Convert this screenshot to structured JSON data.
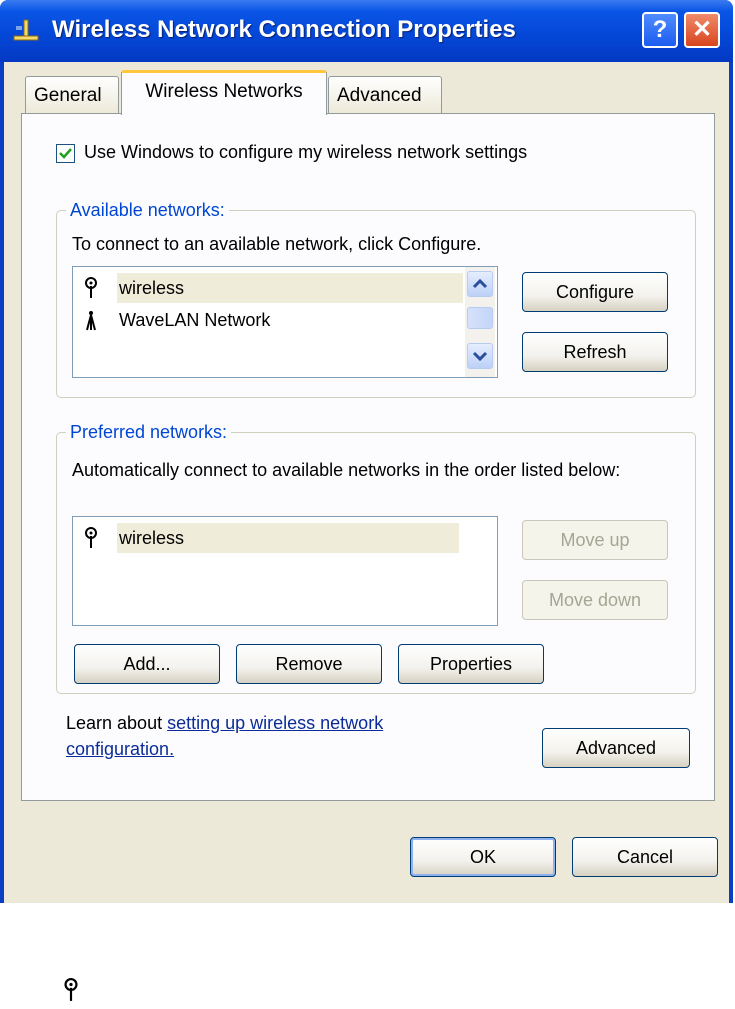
{
  "window": {
    "title": "Wireless Network Connection Properties",
    "help_glyph": "?",
    "close_glyph": "✕"
  },
  "tabs": [
    {
      "label": "General",
      "active": false
    },
    {
      "label": "Wireless Networks",
      "active": true
    },
    {
      "label": "Advanced",
      "active": false
    }
  ],
  "use_windows_checkbox": {
    "label": "Use Windows to configure my wireless network settings",
    "checked": true
  },
  "available": {
    "title": "Available networks:",
    "instructions": "To connect to an available network, click Configure.",
    "networks": [
      {
        "name": "wireless",
        "icon": "antenna-icon",
        "selected": true
      },
      {
        "name": "WaveLAN Network",
        "icon": "ad-hoc-antenna-icon",
        "selected": false
      }
    ],
    "configure_label": "Configure",
    "refresh_label": "Refresh"
  },
  "preferred": {
    "title": "Preferred networks:",
    "instructions": "Automatically connect to available networks in the order listed below:",
    "networks": [
      {
        "name": "wireless",
        "icon": "antenna-icon",
        "selected": true
      }
    ],
    "move_up_label": "Move up",
    "move_down_label": "Move down",
    "add_label": "Add...",
    "remove_label": "Remove",
    "properties_label": "Properties"
  },
  "learn": {
    "prefix": "Learn about ",
    "link_text_1": "setting up wireless network",
    "link_text_2": "configuration."
  },
  "advanced_button_label": "Advanced",
  "ok_label": "OK",
  "cancel_label": "Cancel",
  "colors": {
    "titlebar": "#0446d6",
    "group_title": "#0046d5",
    "link": "#0b2c98",
    "selected_row": "#f0ecda"
  }
}
